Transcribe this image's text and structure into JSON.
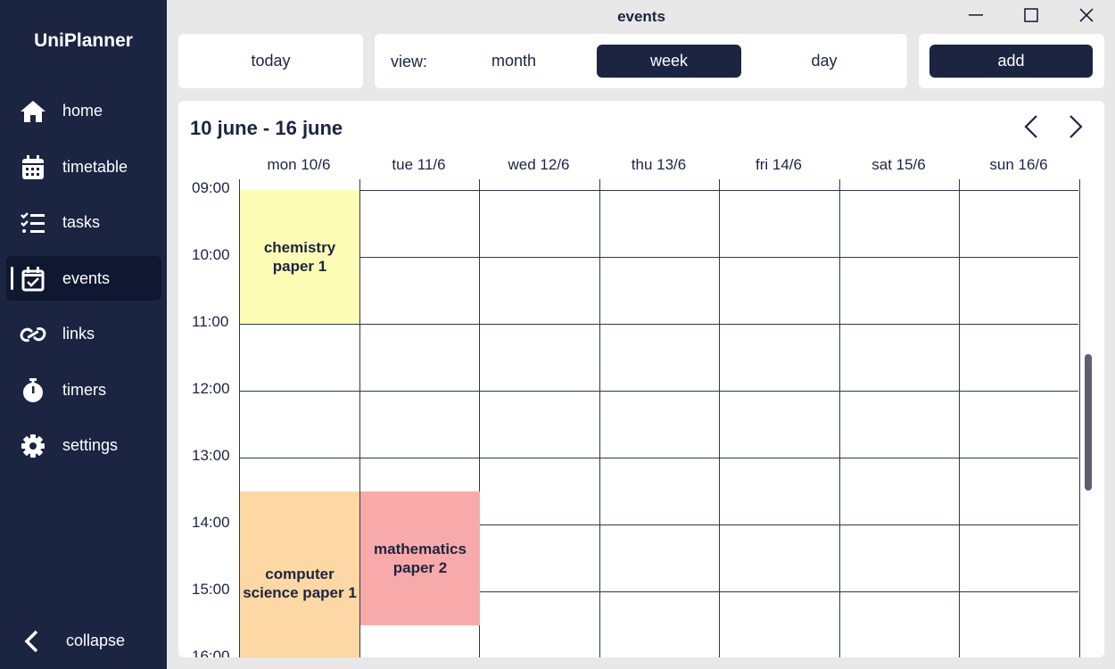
{
  "app": {
    "title": "UniPlanner"
  },
  "window": {
    "title": "events"
  },
  "sidebar": {
    "items": [
      {
        "label": "home",
        "icon": "home-icon"
      },
      {
        "label": "timetable",
        "icon": "calendar-icon"
      },
      {
        "label": "tasks",
        "icon": "tasks-icon"
      },
      {
        "label": "events",
        "icon": "calendar-check-icon",
        "active": true
      },
      {
        "label": "links",
        "icon": "link-icon"
      },
      {
        "label": "timers",
        "icon": "stopwatch-icon"
      },
      {
        "label": "settings",
        "icon": "gear-icon"
      }
    ],
    "collapse_label": "collapse"
  },
  "toolbar": {
    "today_label": "today",
    "view_label": "view:",
    "views": [
      "month",
      "week",
      "day"
    ],
    "selected_view": "week",
    "add_label": "add"
  },
  "calendar": {
    "range_title": "10 june - 16 june",
    "days": [
      "mon 10/6",
      "tue 11/6",
      "wed 12/6",
      "thu 13/6",
      "fri 14/6",
      "sat 15/6",
      "sun 16/6"
    ],
    "times": [
      "09:00",
      "10:00",
      "11:00",
      "12:00",
      "13:00",
      "14:00",
      "15:00",
      "16:00"
    ],
    "events": [
      {
        "title": "chemistry paper 1",
        "day": "mon 10/6",
        "start": "09:00",
        "end": "11:00",
        "color": "#fdfdb5"
      },
      {
        "title": "computer science paper 1",
        "day": "mon 10/6",
        "start": "13:30",
        "end": "16:15",
        "color": "#fdd7a4"
      },
      {
        "title": "mathematics paper 2",
        "day": "tue 11/6",
        "start": "13:30",
        "end": "15:30",
        "color": "#f8aaaa"
      }
    ]
  },
  "colors": {
    "primary": "#1b2541",
    "background": "#e8e8e8"
  }
}
